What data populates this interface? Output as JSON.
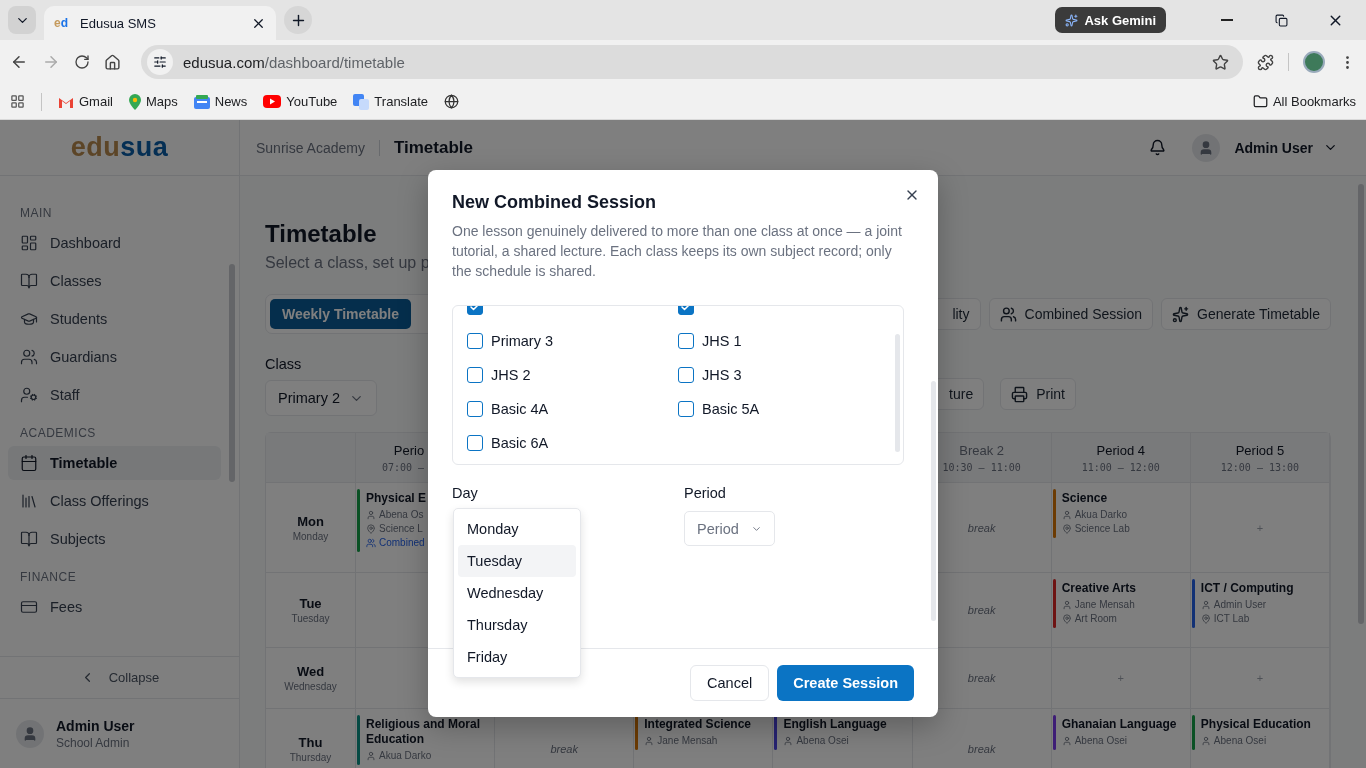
{
  "browser": {
    "tab_title": "Edusua SMS",
    "favicon_a": "e",
    "favicon_b": "d",
    "url_host": "edusua.com",
    "url_path": "/dashboard/timetable",
    "gemini": "Ask Gemini",
    "bookmarks": [
      {
        "label": "Gmail",
        "kind": "gmail"
      },
      {
        "label": "Maps",
        "kind": "maps"
      },
      {
        "label": "News",
        "kind": "news"
      },
      {
        "label": "YouTube",
        "kind": "youtube"
      },
      {
        "label": "Translate",
        "kind": "translate"
      },
      {
        "kind": "globe"
      }
    ],
    "all_bookmarks": "All Bookmarks"
  },
  "app": {
    "logo_a": "edu",
    "logo_b": "sua",
    "school": "Sunrise Academy",
    "page": "Timetable",
    "user": "Admin User"
  },
  "sidebar": {
    "sections": [
      {
        "title": "MAIN",
        "items": [
          {
            "label": "Dashboard",
            "selected": false
          },
          {
            "label": "Classes",
            "selected": false
          },
          {
            "label": "Students",
            "selected": false
          },
          {
            "label": "Guardians",
            "selected": false
          },
          {
            "label": "Staff",
            "selected": false
          }
        ]
      },
      {
        "title": "ACADEMICS",
        "items": [
          {
            "label": "Timetable",
            "selected": true
          },
          {
            "label": "Class Offerings",
            "selected": false
          },
          {
            "label": "Subjects",
            "selected": false
          }
        ]
      },
      {
        "title": "FINANCE",
        "items": [
          {
            "label": "Fees",
            "selected": false
          }
        ]
      }
    ],
    "collapse": "Collapse",
    "user": {
      "name": "Admin User",
      "role": "School Admin"
    }
  },
  "content": {
    "title": "Timetable",
    "subtitle": "Select a class, set up p",
    "tabs": [
      {
        "label": "Weekly Timetable",
        "selected": true
      }
    ],
    "actions": [
      {
        "label": "lity"
      },
      {
        "label": "Combined Session"
      },
      {
        "label": "Generate Timetable"
      }
    ],
    "class_label": "Class",
    "class_value": "Primary 2",
    "view_actions": [
      {
        "label": "ture"
      },
      {
        "label": "Print"
      }
    ]
  },
  "timetable": {
    "columns": [
      {
        "label": "Perio",
        "time": "07:00 –",
        "kind": "clipped"
      },
      {
        "kind": "covered"
      },
      {
        "kind": "covered"
      },
      {
        "kind": "covered"
      },
      {
        "label": "Break 2",
        "time": "10:30 – 11:00",
        "kind": "break"
      },
      {
        "label": "Period 4",
        "time": "11:00 – 12:00",
        "kind": "period"
      },
      {
        "label": "Period 5",
        "time": "12:00 – 13:00",
        "kind": "period"
      }
    ],
    "rows": [
      {
        "day": "Mon",
        "day_full": "Monday",
        "cells": [
          {
            "kind": "lesson",
            "subject": "Physical E",
            "teacher": "Abena Os",
            "room": "Science L",
            "combined": "Combined",
            "color": "#0b5125"
          },
          {
            "kind": "covered"
          },
          {
            "kind": "covered"
          },
          {
            "kind": "covered"
          },
          {
            "kind": "break",
            "text": "break"
          },
          {
            "kind": "lesson",
            "subject": "Science",
            "teacher": "Akua Darko",
            "room": "Science Lab",
            "color": "#6c3b03"
          },
          {
            "kind": "empty",
            "text": "+"
          }
        ]
      },
      {
        "day": "Tue",
        "day_full": "Tuesday",
        "cells": [
          {
            "kind": "covered"
          },
          {
            "kind": "covered"
          },
          {
            "kind": "covered"
          },
          {
            "kind": "covered"
          },
          {
            "kind": "break",
            "text": "break"
          },
          {
            "kind": "lesson",
            "subject": "Creative Arts",
            "teacher": "Jane Mensah",
            "room": "Art Room",
            "color": "#6e1313"
          },
          {
            "kind": "lesson",
            "subject": "ICT / Computing",
            "teacher": "Admin User",
            "room": "ICT Lab",
            "color": "#123175"
          }
        ]
      },
      {
        "day": "Wed",
        "day_full": "Wednesday",
        "cells": [
          {
            "kind": "covered"
          },
          {
            "kind": "covered"
          },
          {
            "kind": "covered"
          },
          {
            "kind": "covered"
          },
          {
            "kind": "break",
            "text": "break"
          },
          {
            "kind": "empty",
            "text": "+"
          },
          {
            "kind": "empty",
            "text": "+"
          }
        ]
      },
      {
        "day": "Thu",
        "day_full": "Thursday",
        "cells": [
          {
            "kind": "lesson",
            "subject": "Religious and Moral Education",
            "teacher": "Akua Darko",
            "color": "#064a44"
          },
          {
            "kind": "break",
            "text": "break"
          },
          {
            "kind": "lesson",
            "subject": "Integrated Science",
            "teacher": "Jane Mensah",
            "color": "#6c3b03"
          },
          {
            "kind": "lesson",
            "subject": "English Language",
            "teacher": "Abena Osei",
            "color": "#272372"
          },
          {
            "kind": "break",
            "text": "break"
          },
          {
            "kind": "lesson",
            "subject": "Ghanaian Language",
            "teacher": "Abena Osei",
            "color": "#3e1d76"
          },
          {
            "kind": "lesson",
            "subject": "Physical Education",
            "teacher": "Abena Osei",
            "color": "#0b5125"
          }
        ]
      }
    ]
  },
  "dialog": {
    "title": "New Combined Session",
    "description": "One lesson genuinely delivered to more than one class at once — a joint tutorial, a shared lecture. Each class keeps its own subject record; only the schedule is shared.",
    "classes": [
      {
        "checked": true
      },
      {
        "checked": true
      },
      {
        "label": "Primary 3",
        "checked": false
      },
      {
        "label": "JHS 1",
        "checked": false
      },
      {
        "label": "JHS 2",
        "checked": false
      },
      {
        "label": "JHS 3",
        "checked": false
      },
      {
        "label": "Basic 4A",
        "checked": false
      },
      {
        "label": "Basic 5A",
        "checked": false
      },
      {
        "label": "Basic 6A",
        "checked": false
      }
    ],
    "day_label": "Day",
    "day_options": [
      {
        "label": "Monday",
        "selected": false
      },
      {
        "label": "Tuesday",
        "selected": true
      },
      {
        "label": "Wednesday",
        "selected": false
      },
      {
        "label": "Thursday",
        "selected": false
      },
      {
        "label": "Friday",
        "selected": false
      }
    ],
    "period_label": "Period",
    "period_placeholder": "Period",
    "cancel": "Cancel",
    "submit": "Create Session"
  }
}
